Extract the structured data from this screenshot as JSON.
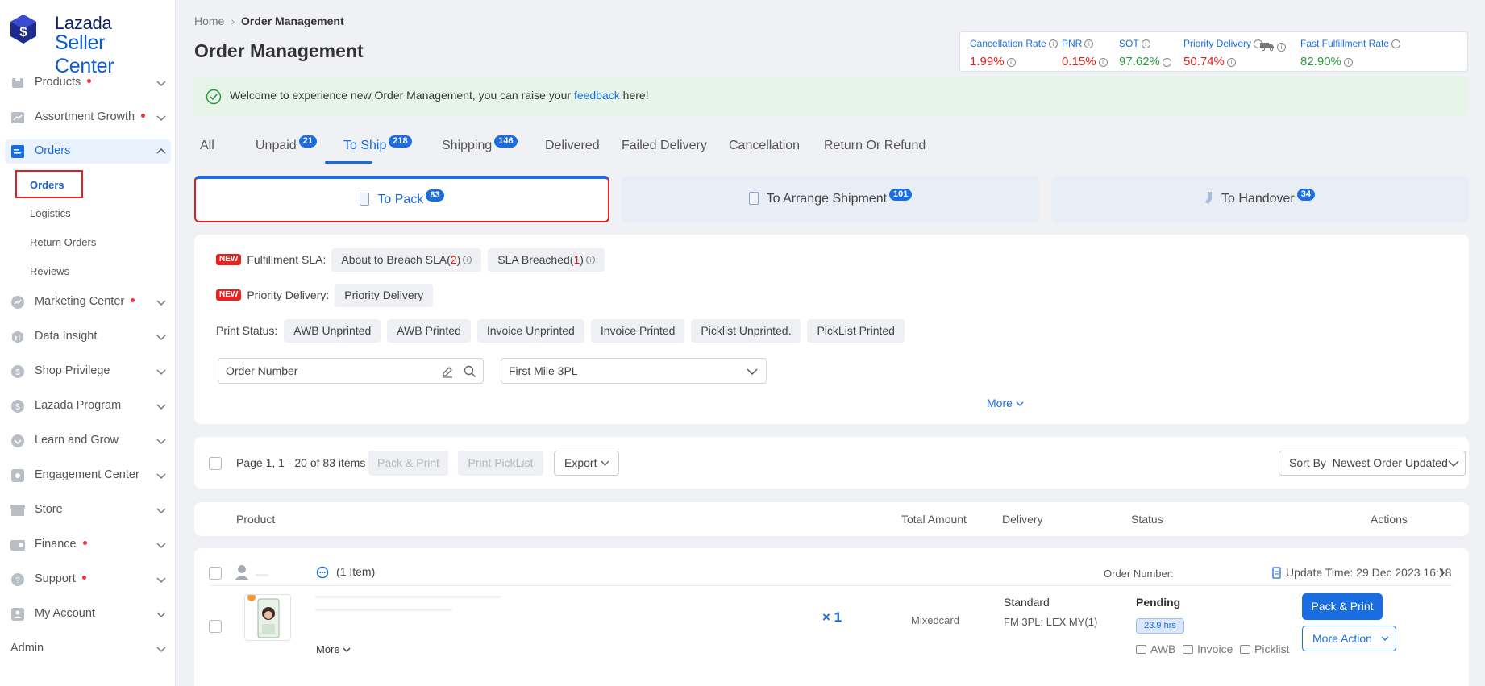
{
  "logo": {
    "line1": "Lazada",
    "line2": "Seller Center"
  },
  "sidebar": {
    "items": [
      {
        "label": "Products",
        "dot": true
      },
      {
        "label": "Assortment Growth",
        "dot": true
      },
      {
        "label": "Orders",
        "dot": false,
        "expanded": true
      },
      {
        "label": "Marketing Center",
        "dot": true
      },
      {
        "label": "Data Insight",
        "dot": false
      },
      {
        "label": "Shop Privilege",
        "dot": false
      },
      {
        "label": "Lazada Program",
        "dot": false
      },
      {
        "label": "Learn and Grow",
        "dot": false
      },
      {
        "label": "Engagement Center",
        "dot": false
      },
      {
        "label": "Store",
        "dot": false
      },
      {
        "label": "Finance",
        "dot": true
      },
      {
        "label": "Support",
        "dot": true
      },
      {
        "label": "My Account",
        "dot": false
      },
      {
        "label": "Admin",
        "dot": false
      }
    ],
    "orders_sub": [
      "Orders",
      "Logistics",
      "Return Orders",
      "Reviews"
    ]
  },
  "breadcrumb": {
    "home": "Home",
    "current": "Order Management"
  },
  "page_title": "Order Management",
  "metrics": [
    {
      "label": "Cancellation Rate",
      "value": "1.99%",
      "status": "red"
    },
    {
      "label": "PNR",
      "value": "0.15%",
      "status": "red"
    },
    {
      "label": "SOT",
      "value": "97.62%",
      "status": "green"
    },
    {
      "label": "Priority Delivery",
      "value": "50.74%",
      "status": "red"
    },
    {
      "label": "Fast Fulfillment Rate",
      "value": "82.90%",
      "status": "green"
    }
  ],
  "banner": {
    "before": "Welcome to experience new Order Management, you can raise your ",
    "link": "feedback",
    "after": " here!"
  },
  "tabs": [
    {
      "label": "All",
      "count": ""
    },
    {
      "label": "Unpaid",
      "count": "21"
    },
    {
      "label": "To Ship",
      "count": "218"
    },
    {
      "label": "Shipping",
      "count": "146"
    },
    {
      "label": "Delivered",
      "count": ""
    },
    {
      "label": "Failed Delivery",
      "count": ""
    },
    {
      "label": "Cancellation",
      "count": ""
    },
    {
      "label": "Return Or Refund",
      "count": ""
    }
  ],
  "active_tab": "To Ship",
  "subtabs": [
    {
      "label": "To Pack",
      "count": "83"
    },
    {
      "label": "To Arrange Shipment",
      "count": "101"
    },
    {
      "label": "To Handover",
      "count": "34"
    }
  ],
  "filters": {
    "new_badge": "NEW",
    "sla_label": "Fulfillment SLA:",
    "sla_chips": [
      {
        "text": "About to Breach SLA(",
        "num": "2",
        "close": ")"
      },
      {
        "text": "SLA Breached(",
        "num": "1",
        "close": ")"
      }
    ],
    "priority_label": "Priority Delivery:",
    "priority_chip": "Priority Delivery",
    "print_label": "Print Status:",
    "print_chips": [
      "AWB Unprinted",
      "AWB Printed",
      "Invoice Unprinted",
      "Invoice Printed",
      "Picklist Unprinted.",
      "PickList Printed"
    ],
    "order_number_placeholder": "Order Number",
    "first_mile": "First Mile 3PL",
    "more": "More"
  },
  "toolbar": {
    "page_info": "Page 1, 1 - 20 of 83 items",
    "pack_print": "Pack & Print",
    "print_picklist": "Print PickList",
    "export": "Export",
    "sort_label": "Sort By",
    "sort_value": "Newest Order Updated"
  },
  "table_headers": {
    "product": "Product",
    "total": "Total Amount",
    "delivery": "Delivery",
    "status": "Status",
    "actions": "Actions"
  },
  "order": {
    "items_count": "(1 Item)",
    "order_number_label": "Order Number:",
    "update_time": "Update Time: 29 Dec 2023 16:18",
    "more": "More",
    "quantity": "× 1",
    "payment": "Mixedcard",
    "delivery_type": "Standard",
    "delivery_3pl": "FM 3PL: LEX MY(1)",
    "status": "Pending",
    "sla_hours": "23.9 hrs",
    "print_awb": "AWB",
    "print_invoice": "Invoice",
    "print_picklist": "Picklist",
    "action_primary": "Pack & Print",
    "action_more": "More Action"
  },
  "colors": {
    "accent": "#1a6de0",
    "highlight_box": "#e02020",
    "banner_bg": "#e6f5e7",
    "danger": "#e0201d",
    "success": "#2a9a3f"
  }
}
